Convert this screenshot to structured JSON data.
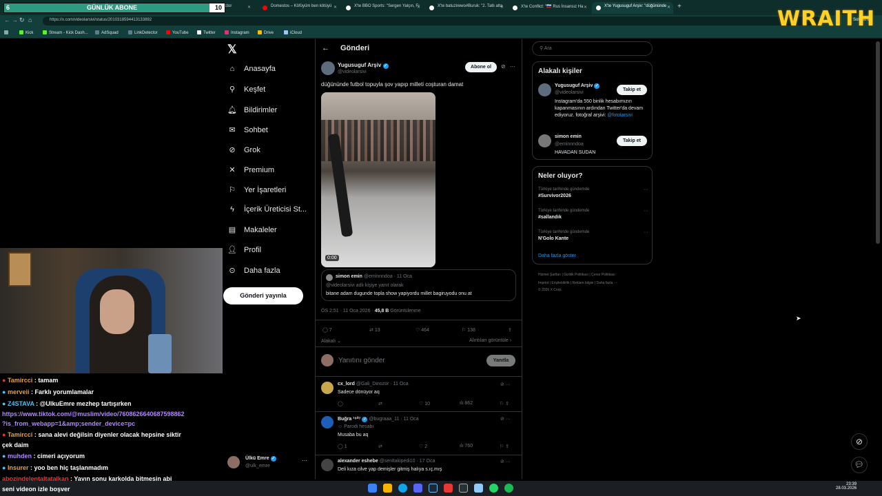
{
  "browser": {
    "tabs": [
      {
        "label": "KickSight LinkDetector",
        "color": "#2e7d32"
      },
      {
        "label": "Domestos – Köfüyüm ben kötüyü",
        "color": "#ff0000"
      },
      {
        "label": "X'te BBO Sports: \"Sergen Yalçın, Fı",
        "color": "#ffffff"
      },
      {
        "label": "X'te batuzirewo#Buruk: \"2. Tatlı alta",
        "color": "#ffffff"
      },
      {
        "label": "X'te Conflict: \"🇷🇺 Rus İnsansız Ha",
        "color": "#ffffff"
      },
      {
        "label": "X'te Yugusuguf Arşiv: \"düğününde",
        "color": "#ffffff"
      }
    ],
    "url": "https://x.com/videolarsivi/status/2010318594413133892",
    "bookmarks": [
      "Kick",
      "Stream - Kick Dash...",
      "AdSquad",
      "LinkDetector",
      "YouTube",
      "Twitter",
      "Instagram",
      "Drive",
      "iCloud"
    ],
    "sohbet_label": "Sohbet et"
  },
  "overlay": {
    "abone_label": "GÜNLÜK ABONE",
    "abone_current": "6",
    "abone_goal": "10",
    "abone_progress_percent": 93,
    "brand": "WRAITH"
  },
  "nav": {
    "items": [
      {
        "label": "Anasayfa",
        "icon": "home-icon"
      },
      {
        "label": "Keşfet",
        "icon": "search-icon"
      },
      {
        "label": "Bildirimler",
        "icon": "bell-icon"
      },
      {
        "label": "Sohbet",
        "icon": "mail-icon"
      },
      {
        "label": "Grok",
        "icon": "grok-icon"
      },
      {
        "label": "Premium",
        "icon": "x-icon"
      },
      {
        "label": "Yer İşaretleri",
        "icon": "bookmark-icon"
      },
      {
        "label": "İçerik Üreticisi St...",
        "icon": "bolt-icon"
      },
      {
        "label": "Makaleler",
        "icon": "article-icon"
      },
      {
        "label": "Profil",
        "icon": "person-icon"
      },
      {
        "label": "Daha fazla",
        "icon": "more-icon"
      }
    ],
    "post_button": "Gönderi yayınla",
    "account_name": "Ülkü Emre",
    "account_handle": "@ulk_emre"
  },
  "post": {
    "header": "Gönderi",
    "author": "Yugusuguf Arşiv",
    "handle": "@videolarsivi",
    "subscribe": "Abone ol",
    "text": "düğününde futbol topuyla şov yapıp milleti coşturan damat",
    "video_time": "0:00",
    "quote_author": "simon emin",
    "quote_handle": "@eminnndoa",
    "quote_date": "11 Oca",
    "quote_reply": "@videolarsivi adlı kişiye yanıt olarak",
    "quote_text": "bitane adam dugunde topla show yapiyordu millet bagiruyodu onu at",
    "time": "ÖS 2:51 · 11 Oca 2026 ·",
    "views": "45,8 B",
    "views_label": "Görüntülenme",
    "replies": "7",
    "reposts": "13",
    "likes": "464",
    "bookmarks": "138",
    "relevance": "Alakalı",
    "quotes_link": "Alıntıları görüntüle",
    "reply_placeholder": "Yanıtını gönder",
    "reply_button": "Yanıtla"
  },
  "replies": [
    {
      "name": "cx_lord",
      "handle": "@Gali_Dinozor · 11 Oca",
      "text": "Sadece dönüyor aq",
      "likes": "10",
      "views": "862",
      "replies": "",
      "parody": ""
    },
    {
      "name": "Buğra ¹⁹⁰⁷",
      "handle": "@bugraaa_11 · 11 Oca",
      "text": "Musaba bu aq",
      "likes": "2",
      "views": "760",
      "replies": "1",
      "parody": "Parodi hesabı"
    },
    {
      "name": "alexander eshebe",
      "handle": "@senltakipedi10 · 17 Oca",
      "text": "Deli kıza cilve yap demişler gitmiş halıya s.ıç.mış",
      "likes": "",
      "views": "",
      "replies": "",
      "parody": ""
    }
  ],
  "sidebar": {
    "search_placeholder": "Ara",
    "people_title": "Alakalı kişiler",
    "people": [
      {
        "name": "Yugusuguf Arşiv",
        "handle": "@videolarsivi",
        "bio": "Instagram'da 550 binlik hesabımızın kapanmasının ardından Twitter'da devam ediyoruz. fotoğraf arşivi:",
        "bio_link": "@fotolarsivi",
        "follow": "Takip et"
      },
      {
        "name": "simon emin",
        "handle": "@eminnndoa",
        "bio": "HAVADAN SUDAN",
        "bio_link": "",
        "follow": "Takip et"
      }
    ],
    "trends_title": "Neler oluyor?",
    "trends": [
      {
        "context": "Türkiye tarihinde gündemde",
        "name": "#Survivor2026"
      },
      {
        "context": "Türkiye tarihinde gündemde",
        "name": "#sallandık"
      },
      {
        "context": "Türkiye tarihinde gündemde",
        "name": "N'Golo Kante"
      }
    ],
    "show_more": "Daha fazla göster",
    "footer1": "Hizmet Şartları  |  Gizlilik Politikası  |  Çerez Politikası",
    "footer2": "Imprint  |  Erişilebilirlik  |  Reklam bilgisi  |  Daha fazla ···",
    "footer3": "© 2026 X Corp."
  },
  "chat": [
    {
      "user": "Tamircci",
      "text": ": tamam",
      "color": "#e9a23b"
    },
    {
      "user": "merveii",
      "text": ": Farklı yorumlamalar",
      "color": "#e9a23b"
    },
    {
      "user": "Z4STAVA",
      "text": ": @UlkuEmre mezhep tartışırken",
      "color": "#4fc3f7"
    },
    {
      "user": "",
      "text": "https://www.tiktok.com/@muslim/video/7608626640687598862",
      "color": "#b388ff"
    },
    {
      "user": "",
      "text": "?is_from_webapp=1&amp;sender_device=pc",
      "color": "#b388ff"
    },
    {
      "user": "Tamircci",
      "text": ": sana alevi değilsin diyenler olacak hepsine siktir",
      "color": "#e9a23b"
    },
    {
      "user": "",
      "text": "çek daim",
      "color": "#ffffff"
    },
    {
      "user": "muhden",
      "text": ": cimeri açıyorum",
      "color": "#b388ff"
    },
    {
      "user": "Insurer",
      "text": ": yoo ben hiç taşlanmadım",
      "color": "#e9a23b"
    },
    {
      "user": "abozindelentaltatalkan",
      "text": ": Yayın sonu karkolda bitmesin abi",
      "color": "#e53935"
    },
    {
      "user": "",
      "text": "seni videon izle boşver",
      "color": "#ffffff"
    }
  ],
  "taskbar": {
    "time": "23:39",
    "date": "28.03.2026"
  }
}
